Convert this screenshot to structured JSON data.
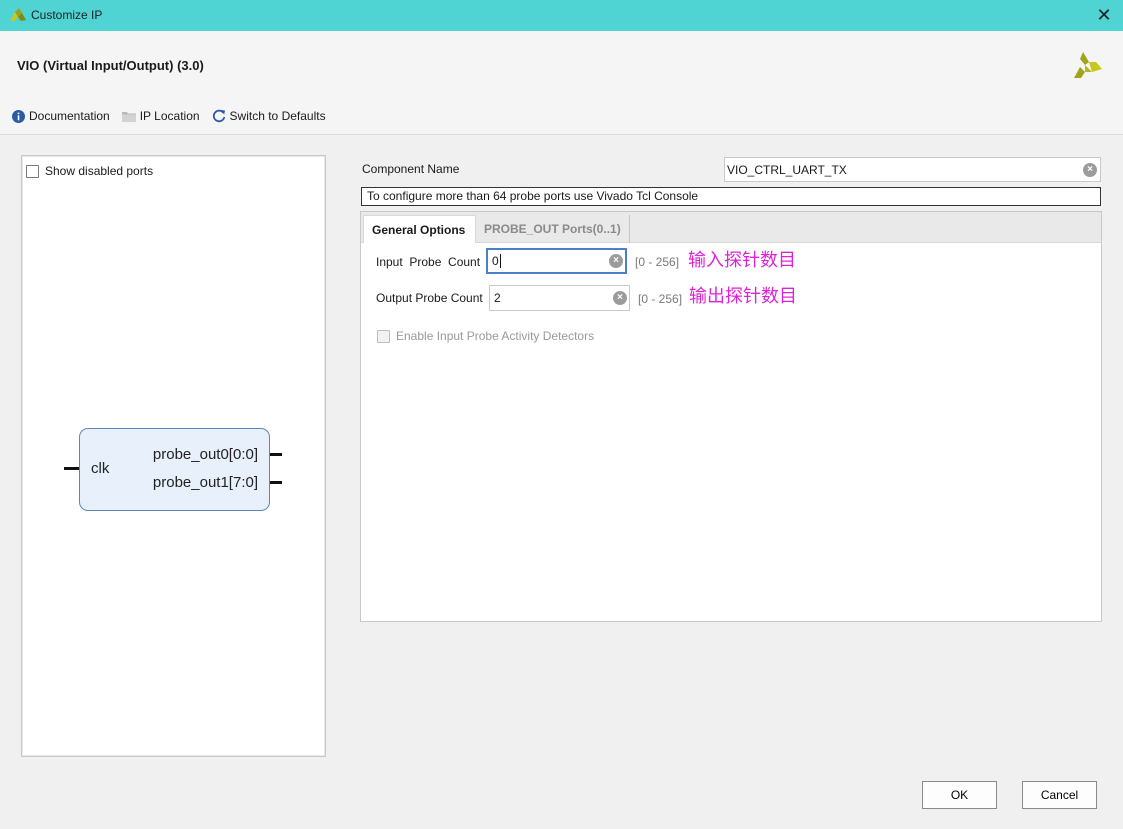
{
  "window": {
    "title": "Customize IP",
    "close_icon": "close-icon"
  },
  "header": {
    "ip_title": "VIO (Virtual Input/Output) (3.0)",
    "toolbar": {
      "documentation": "Documentation",
      "ip_location": "IP Location",
      "switch_to_defaults": "Switch to Defaults"
    }
  },
  "left_panel": {
    "show_disabled_ports": "Show disabled ports",
    "block": {
      "input_port": "clk",
      "output_ports": [
        "probe_out0[0:0]",
        "probe_out1[7:0]"
      ]
    }
  },
  "right_panel": {
    "component_name_label": "Component Name",
    "component_name_value": "VIO_CTRL_UART_TX",
    "notice": "To configure more than 64 probe ports use Vivado Tcl Console",
    "tabs": [
      {
        "label": "General Options",
        "active": true
      },
      {
        "label": "PROBE_OUT Ports(0..1)",
        "active": false
      }
    ],
    "input_probe_count": {
      "label": "Input  Probe  Count",
      "value": "0",
      "range": "[0 - 256]",
      "annotation": "输入探针数目"
    },
    "output_probe_count": {
      "label": "Output Probe Count",
      "value": "2",
      "range": "[0 - 256]",
      "annotation": "输出探针数目"
    },
    "enable_activity_detectors": "Enable Input Probe Activity Detectors"
  },
  "footer": {
    "ok": "OK",
    "cancel": "Cancel"
  },
  "colors": {
    "titlebar": "#4fd3d3",
    "annotation": "#e022d6",
    "focus": "#4a80c8",
    "block_fill": "#e8f1fb",
    "block_border": "#5b86b5"
  }
}
